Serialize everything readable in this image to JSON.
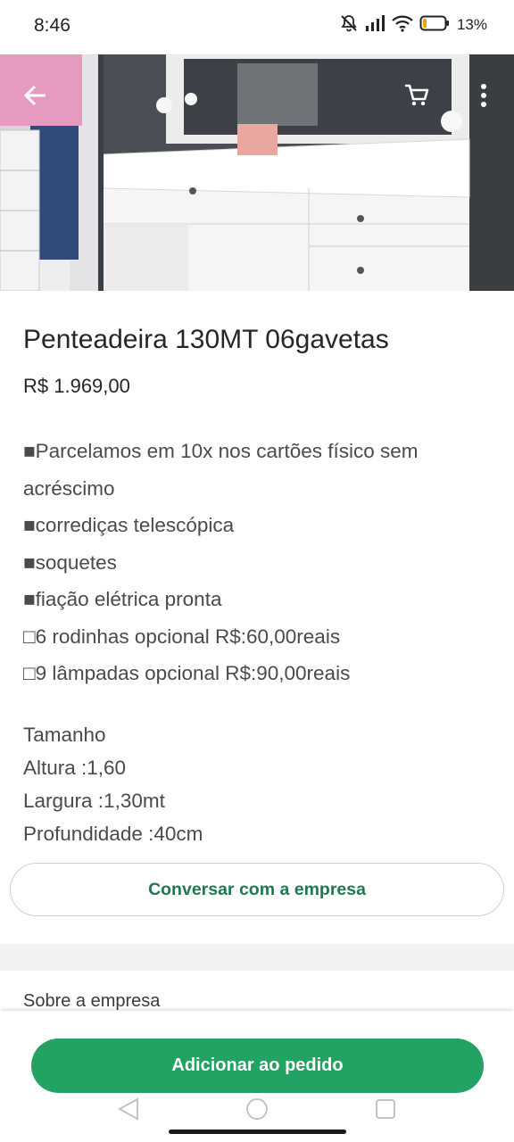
{
  "status_bar": {
    "time": "8:46",
    "battery": "13%",
    "icons": [
      "bell-muted-icon",
      "signal-icon",
      "wifi-icon",
      "battery-icon"
    ]
  },
  "header": {
    "icons": [
      "back-arrow-icon",
      "cart-icon",
      "more-vertical-icon"
    ]
  },
  "product": {
    "title": "Penteadeira 130MT 06gavetas",
    "price": "R$ 1.969,00",
    "description": [
      "■Parcelamos em 10x nos cartões físico sem acréscimo",
      "■corrediças telescópica",
      "■soquetes",
      "■fiação elétrica pronta",
      "□6 rodinhas opcional R$:60,00reais",
      "□9 lâmpadas opcional R$:90,00reais"
    ],
    "size": {
      "heading": "Tamanho",
      "height": "Altura :1,60",
      "width": "Largura :1,30mt",
      "depth": "Profundidade :40cm"
    }
  },
  "actions": {
    "chat": "Conversar com a empresa",
    "add_to_order": "Adicionar ao pedido"
  },
  "about": {
    "title": "Sobre a empresa"
  },
  "colors": {
    "accent_green": "#22a263",
    "chat_text_green": "#1c7a50"
  }
}
